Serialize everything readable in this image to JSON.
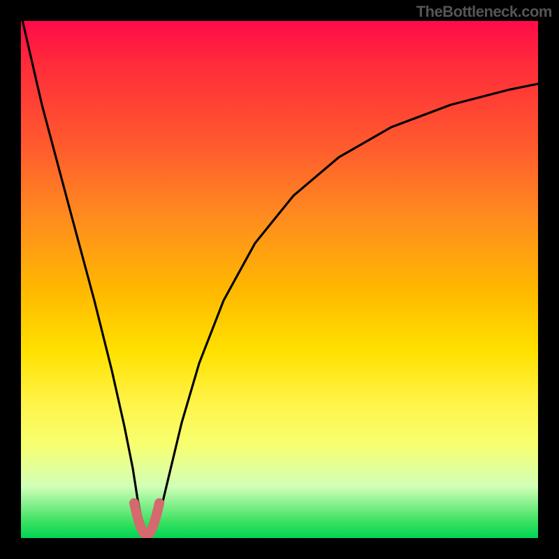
{
  "watermark": "TheBottleneck.com",
  "chart_data": {
    "type": "line",
    "title": "",
    "xlabel": "",
    "ylabel": "",
    "xlim": [
      0,
      100
    ],
    "ylim": [
      0,
      100
    ],
    "x": [
      0,
      5,
      10,
      14,
      17,
      19,
      21,
      22,
      23,
      24,
      25,
      26,
      27,
      28,
      30,
      33,
      37,
      42,
      48,
      55,
      63,
      72,
      82,
      92,
      100
    ],
    "values": [
      100,
      80,
      59,
      42,
      28,
      17,
      8,
      4,
      1,
      0,
      0,
      0,
      1,
      3,
      8,
      17,
      28,
      40,
      51,
      60,
      68,
      74,
      79,
      82,
      84
    ],
    "optimal_x": 24,
    "gradient_stops": [
      {
        "pos": 0.0,
        "color": "#ff0a4a"
      },
      {
        "pos": 0.24,
        "color": "#ff5a2e"
      },
      {
        "pos": 0.52,
        "color": "#ffb800"
      },
      {
        "pos": 0.74,
        "color": "#fff44a"
      },
      {
        "pos": 0.9,
        "color": "#d2ffb8"
      },
      {
        "pos": 1.0,
        "color": "#00d455"
      }
    ],
    "highlight": {
      "color": "#d4696e",
      "x_range": [
        21,
        27
      ],
      "y_range": [
        0,
        6
      ]
    }
  }
}
